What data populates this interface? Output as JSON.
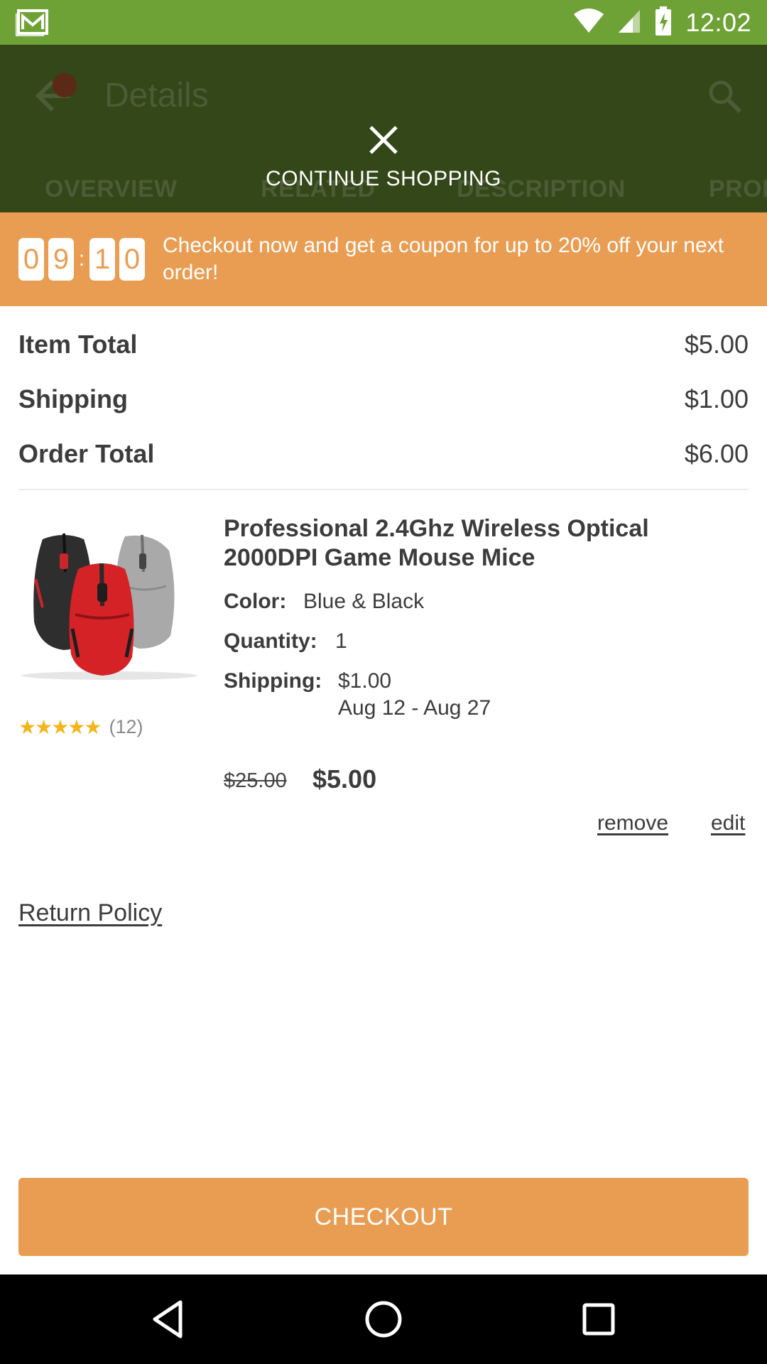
{
  "status_bar": {
    "time": "12:02",
    "icons": [
      "mail-notification-icon",
      "wifi-icon",
      "signal-icon",
      "battery-charging-icon"
    ],
    "color": "#6fa236"
  },
  "app_bar": {
    "title": "Details",
    "tabs": [
      "OVERVIEW",
      "RELATED",
      "DESCRIPTION",
      "PROD"
    ],
    "continue_label": "CONTINUE SHOPPING",
    "color": "#334718"
  },
  "promo": {
    "timer_digits": [
      "0",
      "9",
      "1",
      "0"
    ],
    "timer_separator": ":",
    "text": "Checkout now and get a coupon for up to 20% off your next order!",
    "color": "#e99d52"
  },
  "totals": {
    "item_total_label": "Item Total",
    "item_total_value": "$5.00",
    "shipping_label": "Shipping",
    "shipping_value": "$1.00",
    "order_total_label": "Order Total",
    "order_total_value": "$6.00"
  },
  "item": {
    "title": "Professional 2.4Ghz Wireless Optical 2000DPI Game Mouse Mice",
    "color_label": "Color:",
    "color_value": "Blue & Black",
    "quantity_label": "Quantity:",
    "quantity_value": "1",
    "shipping_label": "Shipping:",
    "shipping_value": "$1.00",
    "shipping_dates": "Aug 12 - Aug 27",
    "old_price": "$25.00",
    "price": "$5.00",
    "rating_stars": "★★★★★",
    "rating": 4.5,
    "rating_count": "(12)",
    "remove_label": "remove",
    "edit_label": "edit"
  },
  "return_policy_label": "Return Policy",
  "checkout_label": "CHECKOUT",
  "accent_color": "#e99d52"
}
